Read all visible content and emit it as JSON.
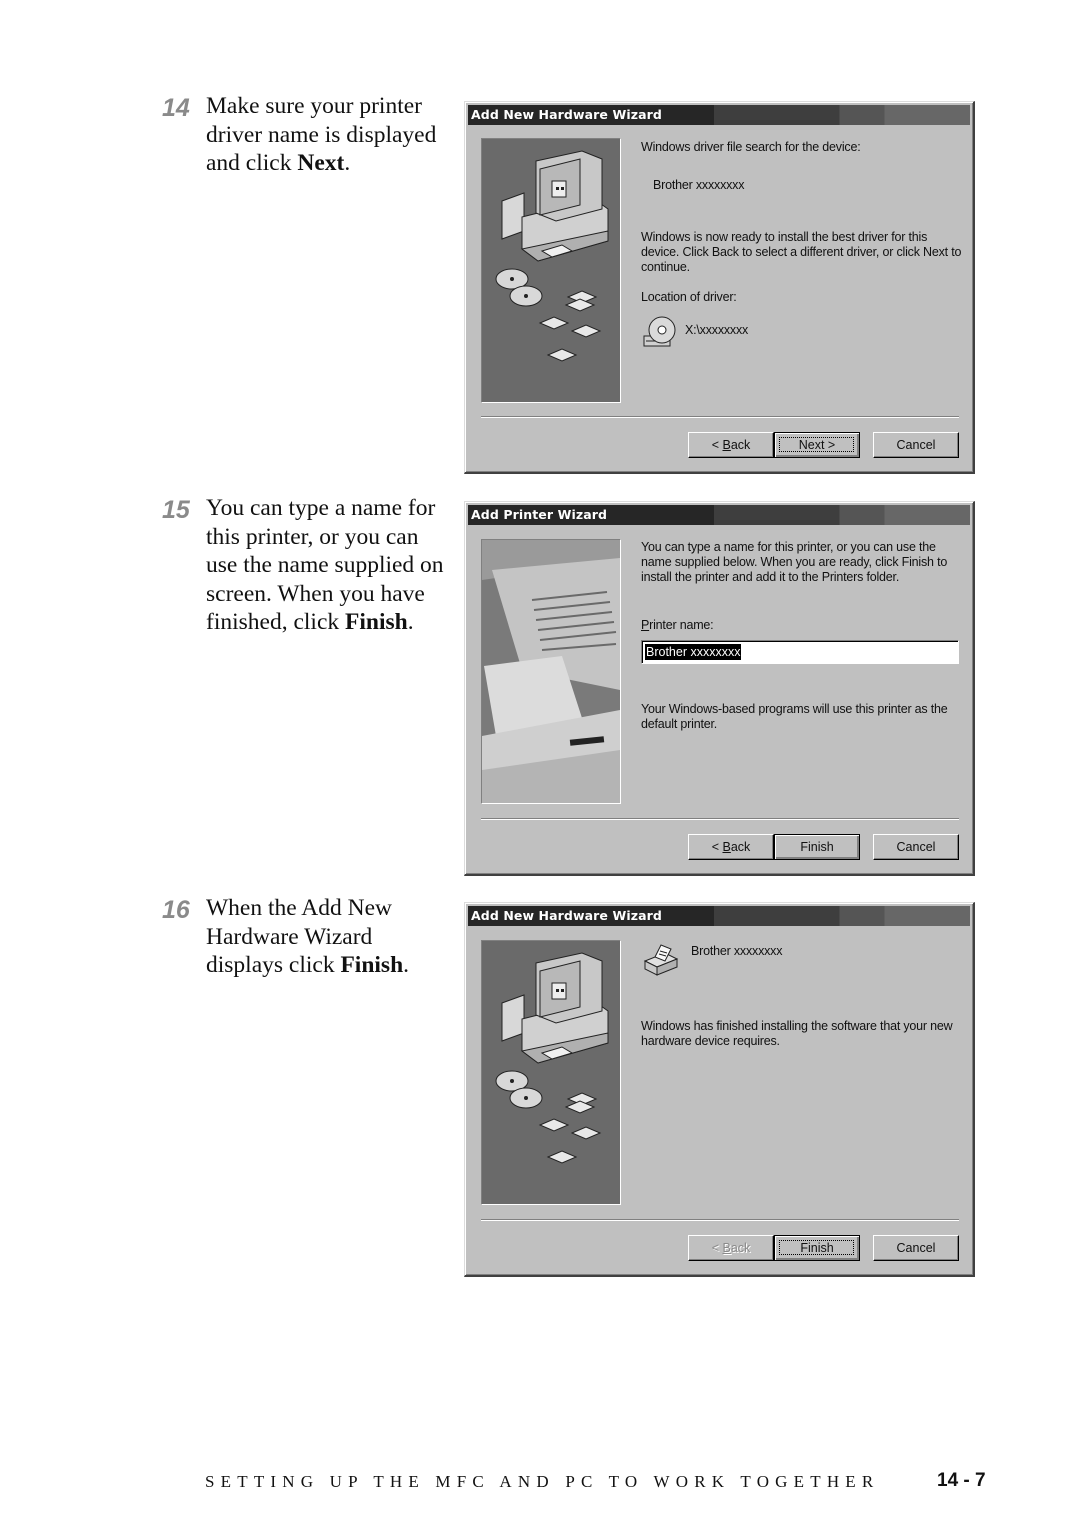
{
  "steps": [
    {
      "number": "14",
      "text_before": "Make sure your printer driver name is displayed and click ",
      "bold": "Next",
      "text_after": "."
    },
    {
      "number": "15",
      "text_before": "You can type a name for this printer, or you can use the name supplied on screen. When you have finished, click ",
      "bold": "Finish",
      "text_after": "."
    },
    {
      "number": "16",
      "text_before": "When the Add New Hardware Wizard displays click ",
      "bold": "Finish",
      "text_after": "."
    }
  ],
  "dialog1": {
    "title": "Add New Hardware Wizard",
    "search_label": "Windows driver file search for the device:",
    "device_name": "Brother  xxxxxxxx",
    "ready_text": "Windows is now ready to install the best driver for this device. Click Back to select a different driver, or click Next to continue.",
    "location_label": "Location of driver:",
    "location_value": "X:\\xxxxxxxx",
    "buttons": {
      "back": "< Back",
      "next": "Next >",
      "cancel": "Cancel"
    }
  },
  "dialog2": {
    "title": "Add Printer Wizard",
    "intro_text": "You can type a name for this printer, or you can use the name supplied below. When you are ready, click Finish to install the printer and add it to the Printers folder.",
    "printer_name_label": "Printer name:",
    "printer_name_value": "Brother  xxxxxxxx",
    "default_text": "Your Windows-based programs will use this printer as the default printer.",
    "buttons": {
      "back": "< Back",
      "finish": "Finish",
      "cancel": "Cancel"
    }
  },
  "dialog3": {
    "title": "Add New Hardware Wizard",
    "device_name": "Brother  xxxxxxxx",
    "finished_text": "Windows has finished installing the software that your new hardware device requires.",
    "buttons": {
      "back": "< Back",
      "finish": "Finish",
      "cancel": "Cancel"
    }
  },
  "footer": {
    "section_title": "SETTING UP THE MFC AND PC TO WORK TOGETHER",
    "page_number": "14 - 7"
  }
}
